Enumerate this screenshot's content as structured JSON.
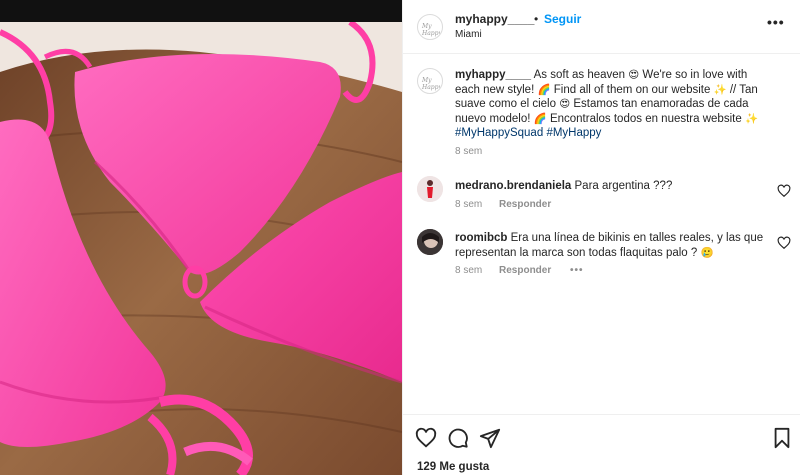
{
  "post": {
    "username": "myhappy____",
    "follow_label": "Seguir",
    "location": "Miami",
    "more_label": "•••",
    "avatar_mark": "My Happy"
  },
  "caption": {
    "username": "myhappy____",
    "text_1": "As soft as heaven",
    "emoji_heart_eyes": "😍",
    "text_2": "We're so in love with each new style!",
    "emoji_rainbow": "🌈",
    "text_3": "Find all of them on our website",
    "emoji_sparkles": "✨",
    "text_4": "// Tan suave como el cielo",
    "text_5": "Estamos tan enamoradas de cada nuevo modelo!",
    "text_6": "Encontralos todos en nuestra website",
    "hashtag_1": "#MyHappySquad",
    "hashtag_2": "#MyHappy",
    "time": "8 sem"
  },
  "comments": [
    {
      "username": "medrano.brendaniela",
      "text": "Para argentina ???",
      "time": "8 sem",
      "reply_label": "Responder"
    },
    {
      "username": "roomibcb",
      "text": "Era una línea de bikinis en talles reales, y las que representan la marca son todas flaquitas palo ?",
      "emoji": "🥲",
      "time": "8 sem",
      "reply_label": "Responder",
      "more_label": "•••"
    }
  ],
  "footer": {
    "likes": "129 Me gusta"
  },
  "icons": {
    "like": "heart-icon",
    "comment": "comment-icon",
    "share": "share-icon",
    "save": "bookmark-icon",
    "comment_like": "heart-icon"
  },
  "colors": {
    "accent": "#0095f6",
    "hashtag": "#00376b",
    "muted": "#8e8e8e",
    "bikini_pink": "#ff3ea5",
    "wood": "#8a5a3a"
  }
}
